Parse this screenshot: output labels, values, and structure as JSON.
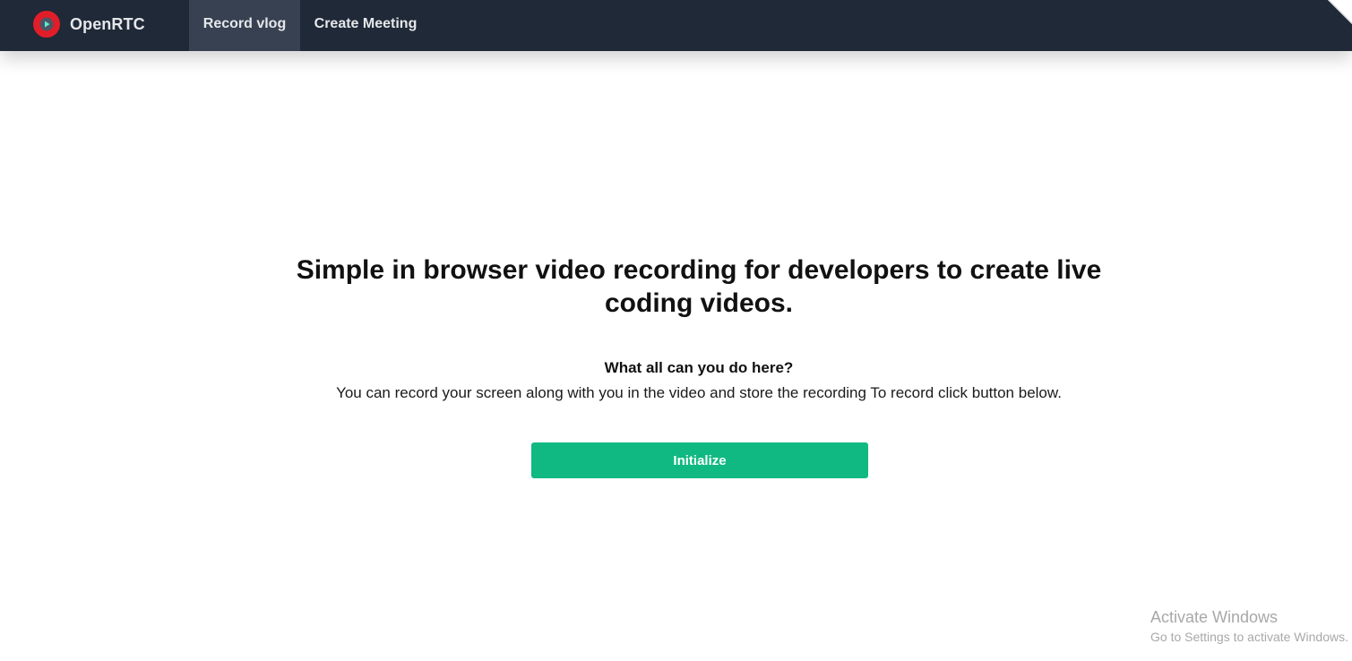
{
  "app": {
    "name": "OpenRTC",
    "logo_icon": "play-circle-icon",
    "accent_color": "#10b981",
    "logo_color": "#e11d2a"
  },
  "nav": {
    "items": [
      {
        "label": "Record vlog",
        "active": true
      },
      {
        "label": "Create Meeting",
        "active": false
      }
    ]
  },
  "main": {
    "headline": "Simple in browser video recording for developers to create live coding videos.",
    "subheading": "What all can you do here?",
    "description": "You can record your screen along with you in the video and store the recording To record click button below.",
    "button_label": "Initialize"
  },
  "watermark": {
    "title": "Activate Windows",
    "subtitle": "Go to Settings to activate Windows."
  }
}
